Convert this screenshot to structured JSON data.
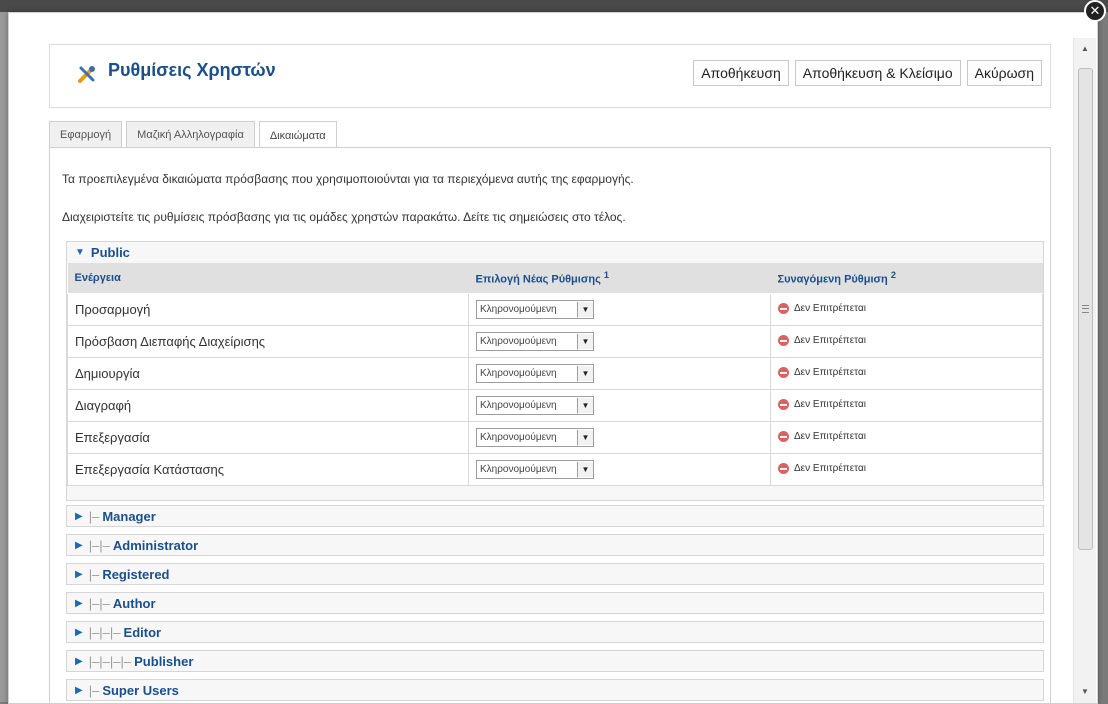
{
  "header": {
    "title": "Ρυθμίσεις Χρηστών",
    "buttons": {
      "save": "Αποθήκευση",
      "save_close": "Αποθήκευση & Κλείσιμο",
      "cancel": "Ακύρωση"
    }
  },
  "tabs": [
    {
      "label": "Εφαρμογή",
      "active": false
    },
    {
      "label": "Μαζική Αλληλογραφία",
      "active": false
    },
    {
      "label": "Δικαιώματα",
      "active": true
    }
  ],
  "intro": {
    "line1": "Τα προεπιλεγμένα δικαιώματα πρόσβασης που χρησιμοποιούνται για τα περιεχόμενα αυτής της εφαρμογής.",
    "line2": "Διαχειριστείτε τις ρυθμίσεις πρόσβασης για τις ομάδες χρηστών παρακάτω. Δείτε τις σημειώσεις στο τέλος."
  },
  "public_group": {
    "name": "Public",
    "columns": {
      "action": "Ενέργεια",
      "new_setting": "Επιλογή Νέας Ρύθμισης",
      "new_setting_note": "1",
      "calculated": "Συναγόμενη Ρύθμιση",
      "calculated_note": "2"
    },
    "rows": [
      {
        "action": "Προσαρμογή",
        "setting": "Κληρονομούμενη",
        "calculated": "Δεν Επιτρέπεται"
      },
      {
        "action": "Πρόσβαση Διεπαφής Διαχείρισης",
        "setting": "Κληρονομούμενη",
        "calculated": "Δεν Επιτρέπεται"
      },
      {
        "action": "Δημιουργία",
        "setting": "Κληρονομούμενη",
        "calculated": "Δεν Επιτρέπεται"
      },
      {
        "action": "Διαγραφή",
        "setting": "Κληρονομούμενη",
        "calculated": "Δεν Επιτρέπεται"
      },
      {
        "action": "Επεξεργασία",
        "setting": "Κληρονομούμενη",
        "calculated": "Δεν Επιτρέπεται"
      },
      {
        "action": "Επεξεργασία Κατάστασης",
        "setting": "Κληρονομούμενη",
        "calculated": "Δεν Επιτρέπεται"
      }
    ]
  },
  "groups": [
    {
      "prefix": "|–",
      "name": "Manager"
    },
    {
      "prefix": "|–|–",
      "name": "Administrator"
    },
    {
      "prefix": "|–",
      "name": "Registered"
    },
    {
      "prefix": "|–|–",
      "name": "Author"
    },
    {
      "prefix": "|–|–|–",
      "name": "Editor"
    },
    {
      "prefix": "|–|–|–|–",
      "name": "Publisher"
    },
    {
      "prefix": "|–",
      "name": "Super Users"
    }
  ],
  "colors": {
    "accent": "#1a4f8b",
    "deny": "#e06060"
  },
  "icons": {
    "header": "tools-icon",
    "close": "close-icon",
    "expanded": "triangle-down-icon",
    "collapsed": "triangle-right-icon",
    "deny": "deny-icon"
  }
}
